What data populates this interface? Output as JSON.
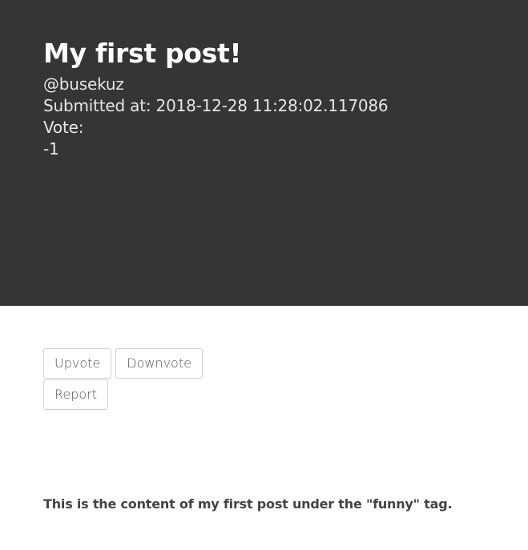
{
  "post": {
    "title": "My first post!",
    "author": "@busekuz",
    "submitted": "Submitted at: 2018-12-28 11:28:02.117086",
    "vote_label": "Vote:",
    "vote_value": "-1",
    "content": "This is the content of my first post under the \"funny\" tag."
  },
  "actions": {
    "upvote_label": "Upvote",
    "downvote_label": "Downvote",
    "report_label": "Report"
  },
  "colors": {
    "hero_background": "#353535",
    "page_background": "#ffffff",
    "button_border": "#cfcfcf"
  }
}
